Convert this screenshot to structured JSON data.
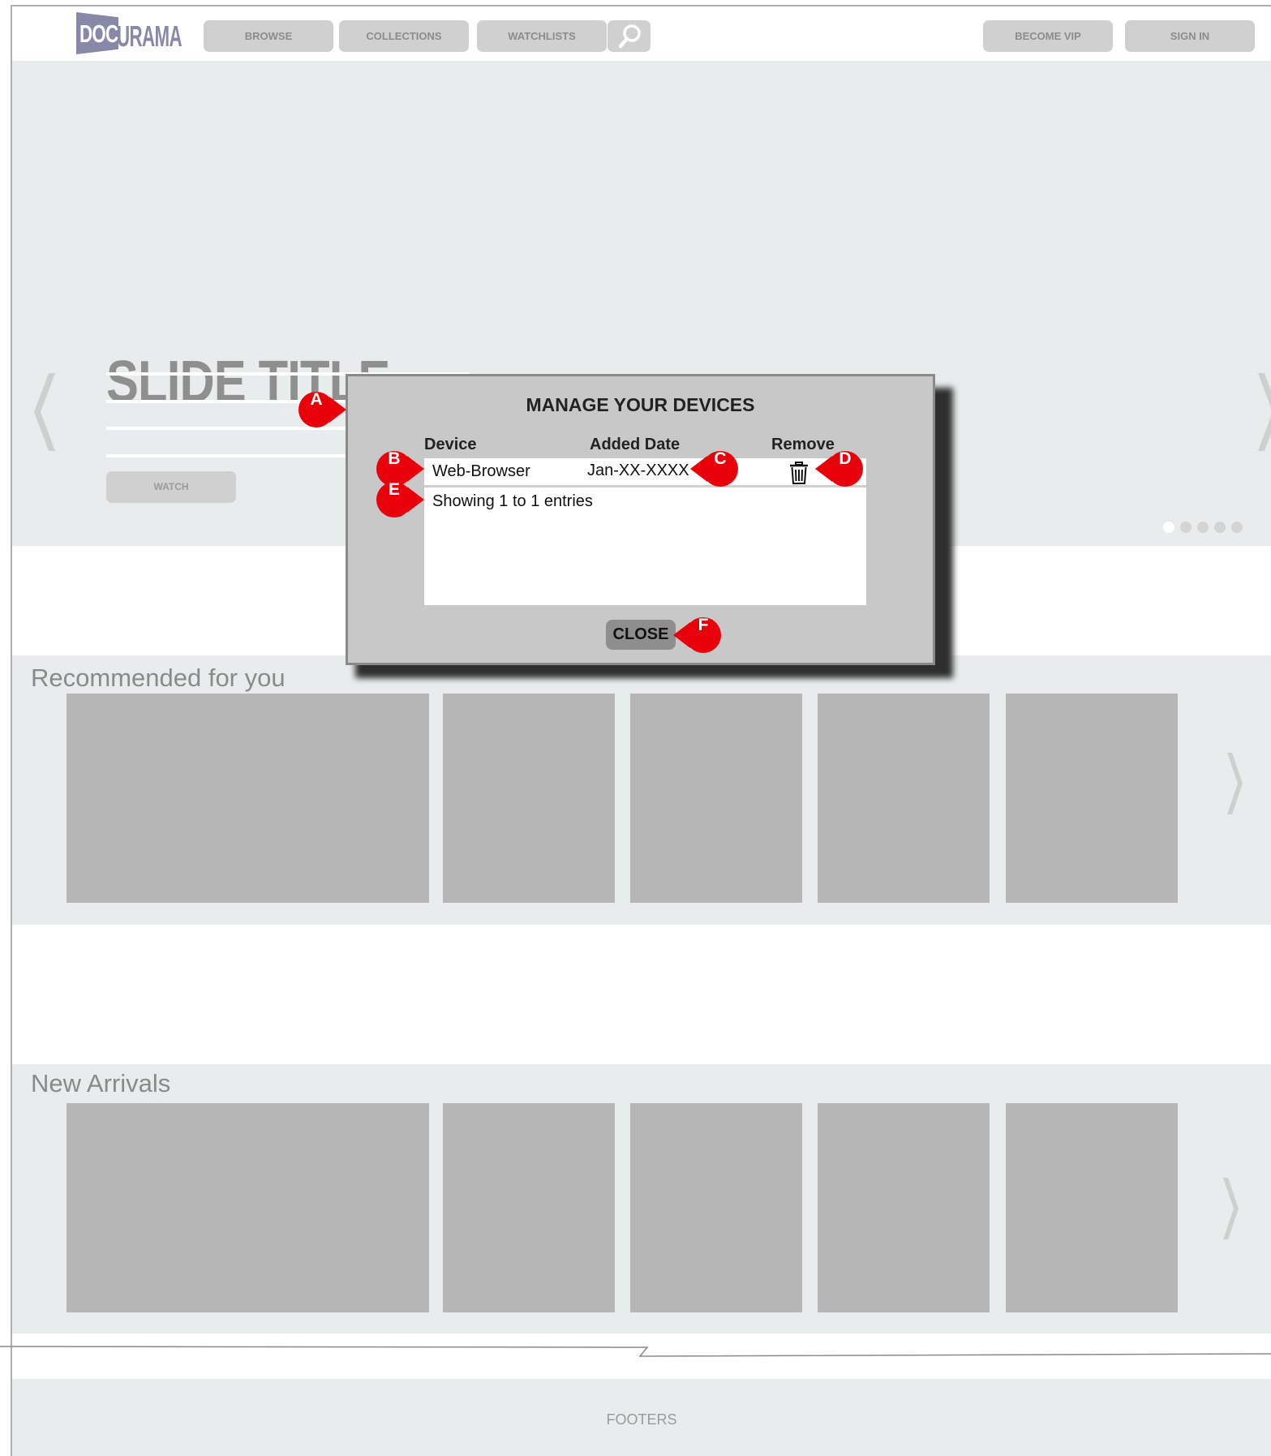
{
  "header": {
    "logo": {
      "part1": "DOC",
      "part2": "URAMA"
    },
    "nav": [
      {
        "label": "BROWSE"
      },
      {
        "label": "COLLECTIONS"
      },
      {
        "label": "WATCHLISTS"
      }
    ],
    "search_icon": "search-icon",
    "right_buttons": [
      {
        "label": "BECOME VIP"
      },
      {
        "label": "SIGN IN"
      }
    ]
  },
  "hero": {
    "title": "SLIDE TITLE",
    "watch_label": "WATCH",
    "slides_total": 5,
    "active_slide": 1,
    "prev_icon": "chevron-left-icon",
    "next_icon": "chevron-right-icon"
  },
  "rows": [
    {
      "title": "Recommended for you"
    },
    {
      "title": "New Arrivals"
    }
  ],
  "footer": {
    "label": "FOOTERS"
  },
  "modal": {
    "title": "MANAGE YOUR DEVICES",
    "columns": [
      "Device",
      "Added Date",
      "Remove"
    ],
    "devices": [
      {
        "device": "Web-Browser",
        "added_date": "Jan-XX-XXXX",
        "remove_icon": "trash-icon"
      }
    ],
    "summary": "Showing 1 to 1 entries",
    "close_label": "CLOSE"
  },
  "callouts": [
    "A",
    "B",
    "C",
    "D",
    "E",
    "F"
  ],
  "colors": {
    "callout": "#e8000b",
    "page_bg": "#e9eced",
    "placeholder": "#b6b6b6",
    "modal_bg": "#c8c8c8",
    "logo": "#8888a8"
  }
}
